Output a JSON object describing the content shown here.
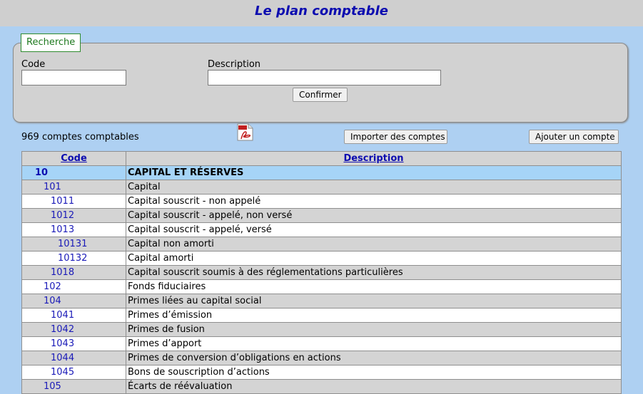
{
  "header": {
    "title": "Le plan comptable"
  },
  "search": {
    "legend": "Recherche",
    "code_label": "Code",
    "code_value": "",
    "description_label": "Description",
    "description_value": "",
    "confirm_label": "Confirmer"
  },
  "toolbar": {
    "count_text": "969 comptes comptables",
    "pdf_icon": "pdf-icon",
    "import_label": "Importer des comptes",
    "add_label": "Ajouter un compte"
  },
  "table": {
    "columns": [
      "Code",
      "Description"
    ],
    "rows": [
      {
        "code": "10",
        "description": "CAPITAL ET RÉSERVES",
        "level": 2
      },
      {
        "code": "101",
        "description": "Capital",
        "level": 3
      },
      {
        "code": "1011",
        "description": "Capital souscrit - non appelé",
        "level": 4
      },
      {
        "code": "1012",
        "description": "Capital souscrit - appelé, non versé",
        "level": 4
      },
      {
        "code": "1013",
        "description": "Capital souscrit - appelé, versé",
        "level": 4
      },
      {
        "code": "10131",
        "description": "Capital non amorti",
        "level": 5
      },
      {
        "code": "10132",
        "description": "Capital amorti",
        "level": 5
      },
      {
        "code": "1018",
        "description": "Capital souscrit soumis à des réglementations particulières",
        "level": 4
      },
      {
        "code": "102",
        "description": "Fonds fiduciaires",
        "level": 3
      },
      {
        "code": "104",
        "description": "Primes liées au capital social",
        "level": 3
      },
      {
        "code": "1041",
        "description": "Primes d’émission",
        "level": 4
      },
      {
        "code": "1042",
        "description": "Primes de fusion",
        "level": 4
      },
      {
        "code": "1043",
        "description": "Primes d’apport",
        "level": 4
      },
      {
        "code": "1044",
        "description": "Primes de conversion d’obligations en actions",
        "level": 4
      },
      {
        "code": "1045",
        "description": "Bons de souscription d’actions",
        "level": 4
      },
      {
        "code": "105",
        "description": "Écarts de réévaluation",
        "level": 3
      }
    ]
  },
  "colors": {
    "background": "#aed0f2",
    "title": "#0b0bb0",
    "link": "#1a1ab8",
    "highlight_row": "#a6d4f7",
    "grey_row": "#d4d4d4"
  }
}
